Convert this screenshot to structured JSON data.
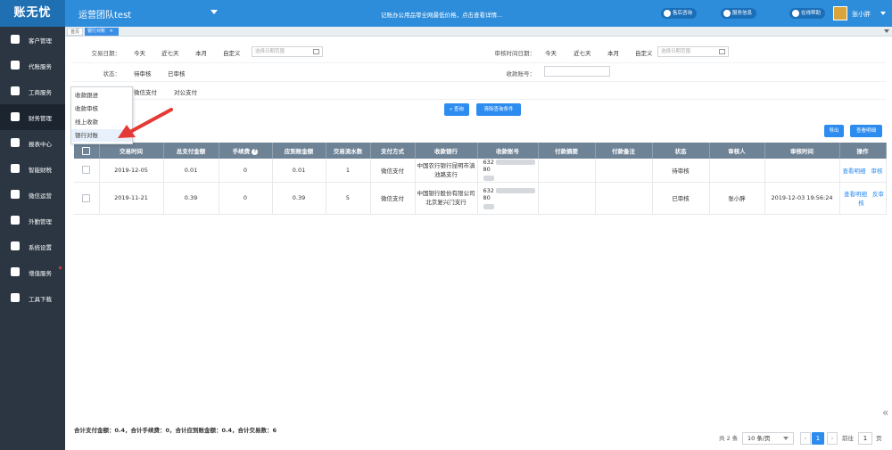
{
  "app": {
    "logo": "账无忧"
  },
  "topbar": {
    "team": "运营团队test",
    "notice": "记账办公用品零全网最低价格，点击查看详情...",
    "after_sales": "售后咨询",
    "service_info": "服务信息",
    "online_help": "在线帮助",
    "user": "张小胖"
  },
  "sidebar": {
    "items": [
      {
        "label": "客户管理",
        "icon": "user-icon"
      },
      {
        "label": "代账服务",
        "icon": "pen-icon"
      },
      {
        "label": "工商服务",
        "icon": "briefcase-icon"
      },
      {
        "label": "财务管理",
        "icon": "ledger-icon"
      },
      {
        "label": "报表中心",
        "icon": "pie-chart-icon"
      },
      {
        "label": "智能财税",
        "icon": "money-bag-icon"
      },
      {
        "label": "微信运营",
        "icon": "wechat-icon"
      },
      {
        "label": "外勤管理",
        "icon": "person-pin-icon"
      },
      {
        "label": "系统设置",
        "icon": "gear-icon"
      },
      {
        "label": "增值服务",
        "icon": "crown-icon"
      },
      {
        "label": "工具下载",
        "icon": "crown-icon"
      }
    ]
  },
  "tabs": {
    "home": "首页",
    "current": "银行对账",
    "close": "×"
  },
  "filters": {
    "trade_date_label": "交易日期：",
    "audit_date_label": "审核时间日期：",
    "date_options": [
      "今天",
      "近七天",
      "本月",
      "自定义"
    ],
    "date_placeholder": "选择日期范围",
    "status_label": "状态：",
    "status_options": [
      "待审核",
      "已审核"
    ],
    "account_label": "收款账号：",
    "pay_type_options": [
      "微信支付",
      "对公支付"
    ],
    "query_button": "查询",
    "clear_button": "清除查询条件"
  },
  "menu": {
    "items": [
      "收款跟进",
      "收款审核",
      "线上收款",
      "银行对账"
    ]
  },
  "toolbar": {
    "export": "导出",
    "view_detail": "查看明细"
  },
  "table": {
    "headers": [
      "交易时间",
      "总支付金额",
      "手续费",
      "应到账金额",
      "交易流水数",
      "支付方式",
      "收款银行",
      "收款账号",
      "付款摘要",
      "付款备注",
      "状态",
      "审核人",
      "审核时间",
      "操作"
    ],
    "rows": [
      {
        "date": "2019-12-05",
        "total": "0.01",
        "fee": "0",
        "due": "0.01",
        "count": "1",
        "pay_type": "微信支付",
        "bank": "中国农行银行昆明市滇池路支行",
        "acct_prefix": "632",
        "acct_suffix": "80",
        "summary": "",
        "remark": "",
        "status": "待审核",
        "auditor": "",
        "audit_time": "",
        "actions": [
          "查看明细",
          "审核"
        ]
      },
      {
        "date": "2019-11-21",
        "total": "0.39",
        "fee": "0",
        "due": "0.39",
        "count": "5",
        "pay_type": "微信支付",
        "bank": "中国银行股份有限公司北京复兴门支行",
        "acct_prefix": "632",
        "acct_suffix": "80",
        "summary": "",
        "remark": "",
        "status": "已审核",
        "auditor": "张小胖",
        "audit_time": "2019-12-03 19:56:24",
        "actions": [
          "查看明细",
          "反审核"
        ]
      }
    ]
  },
  "footer": {
    "summary": "合计支付金额：0.4，合计手续费：0，合计应到账金额：0.4，合计交易数：6",
    "total": "共 2 条",
    "page_size": "10 条/页",
    "current_page": "1",
    "goto_label": "前往",
    "goto_value": "1",
    "page_unit": "页"
  },
  "colors": {
    "topbar": "#2e8ddb",
    "sidebar": "#2b3642",
    "header": "#6f8396",
    "accent": "#2d8cf0",
    "arrow": "#e53935"
  }
}
